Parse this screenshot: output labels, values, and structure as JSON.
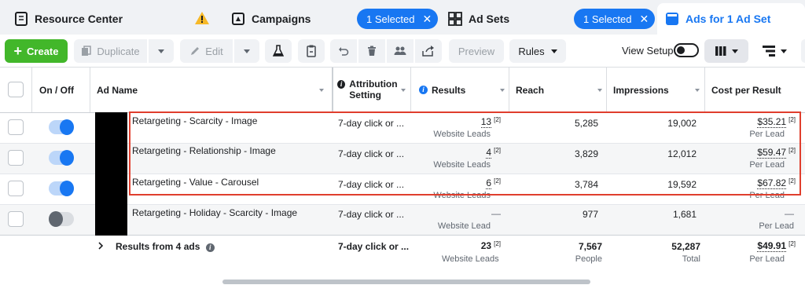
{
  "tabs": [
    {
      "label": "Resource Center",
      "icon": "resource-center-icon"
    },
    {
      "label": "Campaigns",
      "icon": "campaigns-icon",
      "pill": "1 Selected"
    },
    {
      "label": "Ad Sets",
      "icon": "ad-sets-icon",
      "pill": "1 Selected"
    },
    {
      "label": "Ads for 1 Ad Set",
      "icon": "ads-icon",
      "active": true
    }
  ],
  "toolbar": {
    "create": "Create",
    "duplicate": "Duplicate",
    "edit": "Edit",
    "preview": "Preview",
    "rules": "Rules",
    "view_setup": "View Setup"
  },
  "columns": {
    "on_off": "On / Off",
    "ad_name": "Ad Name",
    "attribution": "Attribution Setting",
    "results": "Results",
    "reach": "Reach",
    "impressions": "Impressions",
    "cost": "Cost per Result"
  },
  "rows": [
    {
      "name": "Retargeting - Scarcity - Image",
      "on": true,
      "attribution": "7-day click or ...",
      "results": "13",
      "results_sup": "[2]",
      "results_sub": "Website Leads",
      "reach": "5,285",
      "impressions": "19,002",
      "cost": "$35.21",
      "cost_sup": "[2]",
      "cost_sub": "Per Lead"
    },
    {
      "name": "Retargeting - Relationship - Image",
      "on": true,
      "attribution": "7-day click or ...",
      "results": "4",
      "results_sup": "[2]",
      "results_sub": "Website Leads",
      "reach": "3,829",
      "impressions": "12,012",
      "cost": "$59.47",
      "cost_sup": "[2]",
      "cost_sub": "Per Lead"
    },
    {
      "name": "Retargeting - Value - Carousel",
      "on": true,
      "attribution": "7-day click or ...",
      "results": "6",
      "results_sup": "[2]",
      "results_sub": "Website Leads",
      "reach": "3,784",
      "impressions": "19,592",
      "cost": "$67.82",
      "cost_sup": "[2]",
      "cost_sub": "Per Lead"
    },
    {
      "name": "Retargeting - Holiday - Scarcity - Image",
      "on": false,
      "attribution": "7-day click or ...",
      "results": "—",
      "results_sup": "",
      "results_sub": "Website Lead",
      "reach": "977",
      "impressions": "1,681",
      "cost": "—",
      "cost_sup": "",
      "cost_sub": "Per Lead"
    }
  ],
  "totals": {
    "label": "Results from 4 ads",
    "attribution": "7-day click or ...",
    "results": "23",
    "results_sup": "[2]",
    "results_sub": "Website Leads",
    "reach": "7,567",
    "reach_sub": "People",
    "impressions": "52,287",
    "impressions_sub": "Total",
    "cost": "$49.91",
    "cost_sup": "[2]",
    "cost_sub": "Per Lead"
  },
  "colors": {
    "accent": "#1877f2",
    "create": "#42b72a",
    "highlight": "#e03e2d",
    "warning": "#f7b928"
  }
}
